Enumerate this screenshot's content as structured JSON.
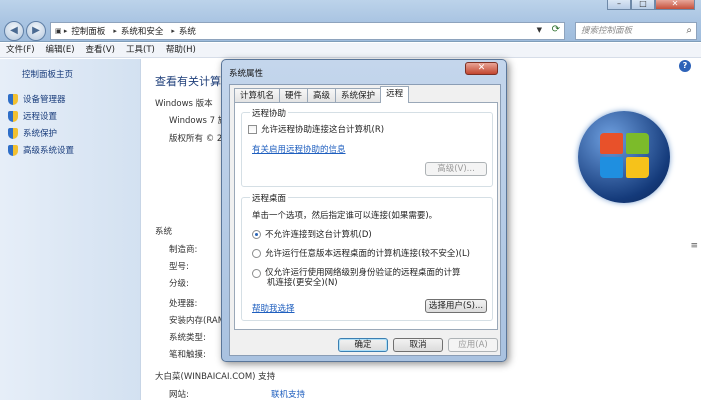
{
  "address": {
    "crumbs": [
      "控制面板",
      "系统和安全",
      "系统"
    ],
    "search_placeholder": "搜索控制面板"
  },
  "menu": [
    "文件(F)",
    "编辑(E)",
    "查看(V)",
    "工具(T)",
    "帮助(H)"
  ],
  "left_pane": {
    "home": "控制面板主页",
    "items": [
      "设备管理器",
      "远程设置",
      "系统保护",
      "高级系统设置"
    ]
  },
  "main": {
    "title": "查看有关计算",
    "edition_heading": "Windows 版本",
    "edition": "Windows 7 旗",
    "copyright": "版权所有 © 2",
    "system_heading": "系统",
    "system_fields": [
      "制造商:",
      "型号:",
      "分级:",
      "处理器:",
      "安装内存(RAM",
      "系统类型:",
      "笔和触摸:"
    ],
    "support_heading": "大白菜(WINBAICAI.COM) 支持",
    "website_label": "网站:",
    "website_value": "联机支持"
  },
  "dialog": {
    "title": "系统属性",
    "tabs": [
      "计算机名",
      "硬件",
      "高级",
      "系统保护",
      "远程"
    ],
    "active_tab": "远程",
    "assist": {
      "heading": "远程协助",
      "checkbox": "允许远程协助连接这台计算机(R)",
      "link": "有关启用远程协助的信息",
      "advanced_button": "高级(V)..."
    },
    "desktop": {
      "heading": "远程桌面",
      "instruction": "单击一个选项，然后指定谁可以连接(如果需要)。",
      "option1": "不允许连接到这台计算机(D)",
      "option2": "允许运行任意版本远程桌面的计算机连接(较不安全)(L)",
      "option3_line1": "仅允许运行使用网络级别身份验证的远程桌面的计算",
      "option3_line2": "机连接(更安全)(N)",
      "help_link": "帮助我选择",
      "select_users": "选择用户(S)..."
    },
    "buttons": {
      "ok": "确定",
      "cancel": "取消",
      "apply": "应用(A)"
    }
  }
}
